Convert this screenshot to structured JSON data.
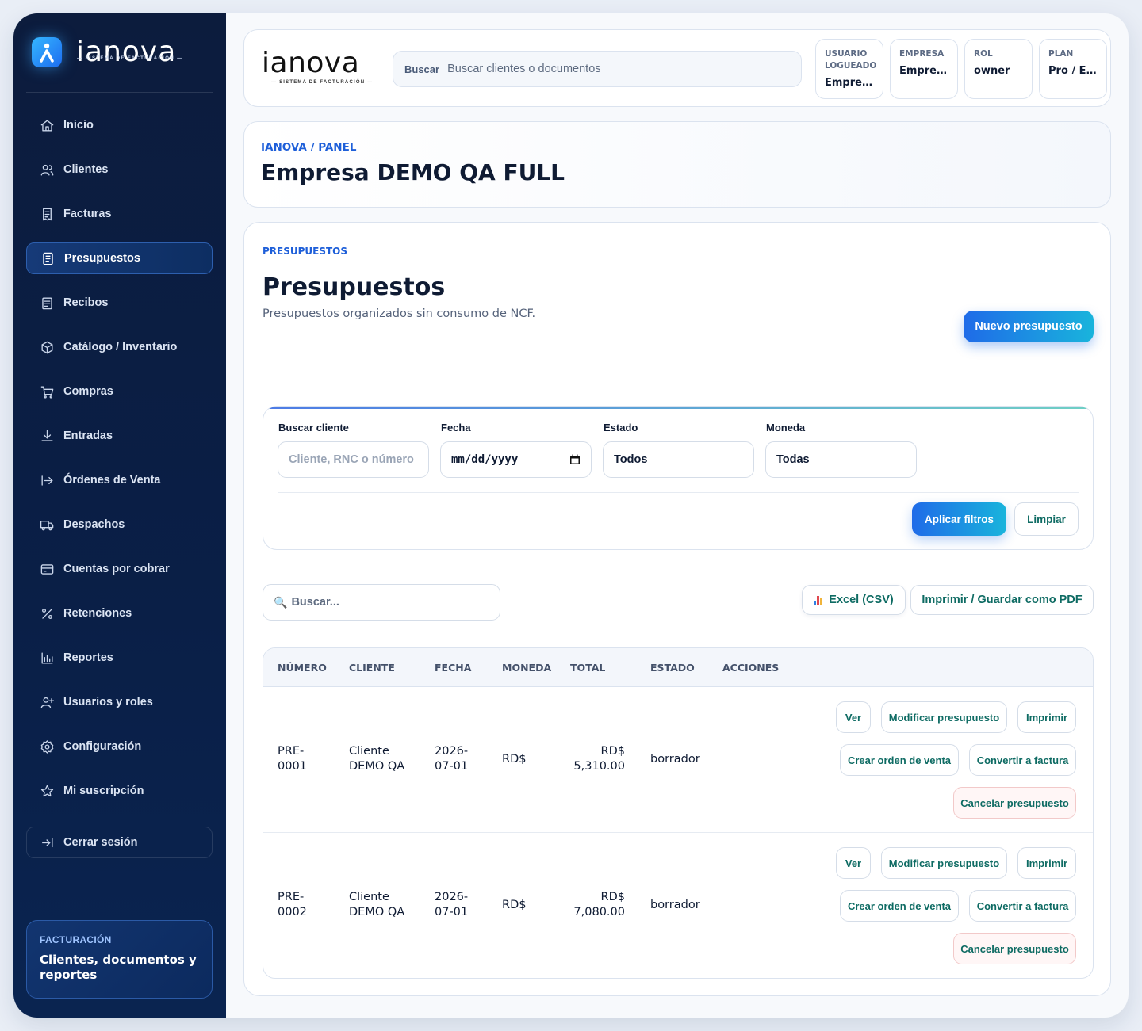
{
  "app": {
    "logo_text": "ianova",
    "logo_sub": "SISTEMA DE FACTURACIÓN"
  },
  "sidebar": {
    "items": [
      {
        "label": "Inicio",
        "icon": "home-icon"
      },
      {
        "label": "Clientes",
        "icon": "users-icon"
      },
      {
        "label": "Facturas",
        "icon": "invoice-icon"
      },
      {
        "label": "Presupuestos",
        "icon": "receipt-icon",
        "active": true
      },
      {
        "label": "Recibos",
        "icon": "receipt-list-icon"
      },
      {
        "label": "Catálogo / Inventario",
        "icon": "box-icon"
      },
      {
        "label": "Compras",
        "icon": "cart-icon"
      },
      {
        "label": "Entradas",
        "icon": "download-icon"
      },
      {
        "label": "Órdenes de Venta",
        "icon": "arrow-right-bar-icon"
      },
      {
        "label": "Despachos",
        "icon": "truck-icon"
      },
      {
        "label": "Cuentas por cobrar",
        "icon": "card-icon"
      },
      {
        "label": "Retenciones",
        "icon": "percent-icon"
      },
      {
        "label": "Reportes",
        "icon": "bar-chart-icon"
      },
      {
        "label": "Usuarios y roles",
        "icon": "user-plus-icon"
      },
      {
        "label": "Configuración",
        "icon": "gear-icon"
      },
      {
        "label": "Mi suscripción",
        "icon": "star-icon"
      }
    ],
    "logout_label": "Cerrar sesión",
    "card": {
      "kicker": "FACTURACIÓN",
      "text": "Clientes, documentos y reportes"
    }
  },
  "topbar": {
    "search_button": "Buscar",
    "search_placeholder": "Buscar clientes o documentos",
    "chips": [
      {
        "key": "USUARIO LOGUEADO",
        "value": "Empres..."
      },
      {
        "key": "EMPRESA",
        "value": "Empres..."
      },
      {
        "key": "ROL",
        "value": "owner"
      },
      {
        "key": "PLAN",
        "value": "Pro / Em..."
      }
    ]
  },
  "header": {
    "breadcrumb": "IANOVA / PANEL",
    "title": "Empresa DEMO QA FULL"
  },
  "page": {
    "kicker": "PRESUPUESTOS",
    "title": "Presupuestos",
    "subtitle": "Presupuestos organizados sin consumo de NCF.",
    "new_button": "Nuevo presupuesto"
  },
  "filters": {
    "client_label": "Buscar cliente",
    "client_placeholder": "Cliente, RNC o número",
    "date_label": "Fecha",
    "date_placeholder": "mm/dd/yyyy",
    "status_label": "Estado",
    "status_value": "Todos",
    "currency_label": "Moneda",
    "currency_value": "Todas",
    "apply_button": "Aplicar filtros",
    "clear_button": "Limpiar"
  },
  "toolbar": {
    "search_placeholder": "Buscar...",
    "excel_button": "Excel (CSV)",
    "pdf_button": "Imprimir / Guardar como PDF"
  },
  "table": {
    "columns": [
      "NÚMERO",
      "CLIENTE",
      "FECHA",
      "MONEDA",
      "TOTAL",
      "ESTADO",
      "ACCIONES"
    ],
    "rows": [
      {
        "number": [
          "PRE-",
          "0001"
        ],
        "client": [
          "Cliente",
          "DEMO QA"
        ],
        "date": [
          "2026-",
          "07-01"
        ],
        "currency": "RD$",
        "total": [
          "RD$",
          "5,310.00"
        ],
        "status": "borrador"
      },
      {
        "number": [
          "PRE-",
          "0002"
        ],
        "client": [
          "Cliente",
          "DEMO QA"
        ],
        "date": [
          "2026-",
          "07-01"
        ],
        "currency": "RD$",
        "total": [
          "RD$",
          "7,080.00"
        ],
        "status": "borrador"
      }
    ],
    "actions": {
      "view": "Ver",
      "edit": "Modificar presupuesto",
      "print": "Imprimir",
      "create_order": "Crear orden de venta",
      "convert": "Convertir a factura",
      "cancel": "Cancelar presupuesto"
    }
  }
}
